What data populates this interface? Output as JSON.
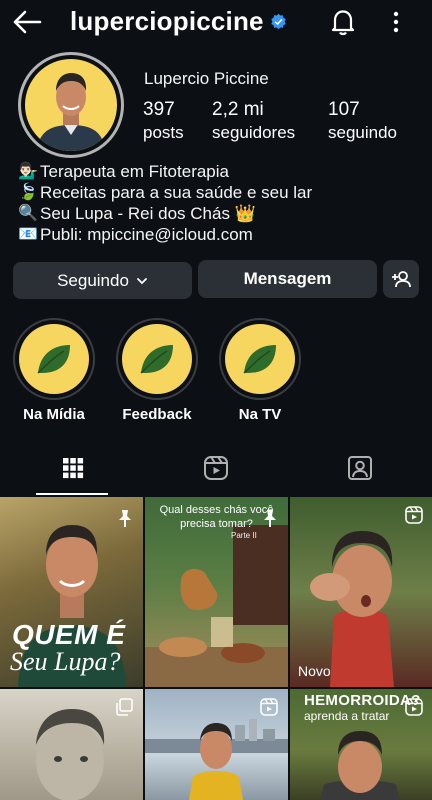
{
  "header": {
    "username": "luperciopiccine",
    "icons": {
      "back": "arrow-left-icon",
      "verified": "verified-badge-icon",
      "notifications": "bell-icon",
      "menu": "more-vertical-icon"
    }
  },
  "profile": {
    "full_name": "Lupercio Piccine",
    "stats": [
      {
        "value": "397",
        "label": "posts"
      },
      {
        "value": "2,2 mi",
        "label": "seguidores"
      },
      {
        "value": "107",
        "label": "seguindo"
      }
    ],
    "bio": [
      {
        "emoji": "💁🏻‍♂️",
        "text": "Terapeuta em Fitoterapia"
      },
      {
        "emoji": "🍃",
        "text": "Receitas para a sua saúde e seu lar"
      },
      {
        "emoji": "🔍",
        "text": "Seu Lupa - Rei dos Chás 👑"
      },
      {
        "emoji": "📧",
        "text": "Publi: mpiccine@icloud.com"
      }
    ]
  },
  "actions": {
    "following_label": "Seguindo",
    "message_label": "Mensagem",
    "add_user_icon": "add-person-icon"
  },
  "highlights": [
    {
      "label": "Na Mídia",
      "icon": "leaf-icon"
    },
    {
      "label": "Feedback",
      "icon": "leaf-icon"
    },
    {
      "label": "Na TV",
      "icon": "leaf-icon"
    }
  ],
  "tabs": [
    {
      "name": "posts",
      "icon": "grid-icon",
      "active": true
    },
    {
      "name": "reels",
      "icon": "reels-icon",
      "active": false
    },
    {
      "name": "tagged",
      "icon": "tagged-icon",
      "active": false
    }
  ],
  "posts": [
    {
      "overlay_line1": "QUEM É",
      "overlay_line2": "Seu Lupa?",
      "pinned": true
    },
    {
      "overlay_line1": "Qual desses chás você precisa tomar?",
      "overlay_line2": "Parte II",
      "pinned": true
    },
    {
      "overlay_line1": "Novo",
      "type": "reel"
    },
    {
      "type": "carousel"
    },
    {
      "type": "reel"
    },
    {
      "overlay_line1": "HEMORROIDA?",
      "overlay_line2": "aprenda a tratar",
      "type": "reel"
    }
  ],
  "colors": {
    "background": "#0c0f14",
    "button": "#2b2f36",
    "verified": "#3897f0",
    "highlight_bg": "#f7d660",
    "leaf": "#2f6b2a"
  }
}
